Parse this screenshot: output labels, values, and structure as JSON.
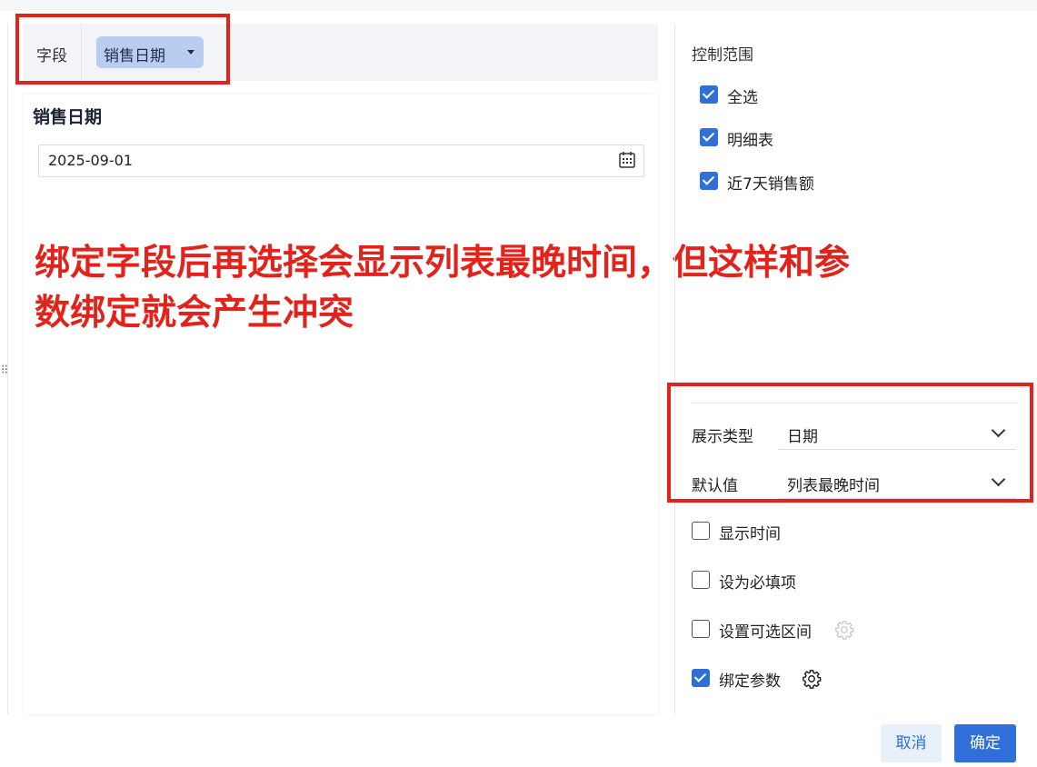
{
  "field": {
    "label": "字段",
    "selected": "销售日期"
  },
  "filter": {
    "title": "销售日期",
    "date_value": "2025-09-01"
  },
  "annotation": {
    "line1": "绑定字段后再选择会显示列表最晚时间，但这样和参",
    "line2": "数绑定就会产生冲突"
  },
  "control_range": {
    "title": "控制范围",
    "items": [
      {
        "label": "全选",
        "checked": true
      },
      {
        "label": "明细表",
        "checked": true
      },
      {
        "label": "近7天销售额",
        "checked": true
      }
    ]
  },
  "display_type": {
    "label": "展示类型",
    "value": "日期"
  },
  "default_value": {
    "label": "默认值",
    "value": "列表最晚时间"
  },
  "options": [
    {
      "label": "显示时间",
      "checked": false
    },
    {
      "label": "设为必填项",
      "checked": false
    },
    {
      "label": "设置可选区间",
      "checked": false
    },
    {
      "label": "绑定参数",
      "checked": true
    }
  ],
  "buttons": {
    "cancel": "取消",
    "confirm": "确定"
  },
  "colors": {
    "accent": "#2f6fd8",
    "annotation_red": "#e3231b",
    "chip": "#b9cdf0"
  }
}
